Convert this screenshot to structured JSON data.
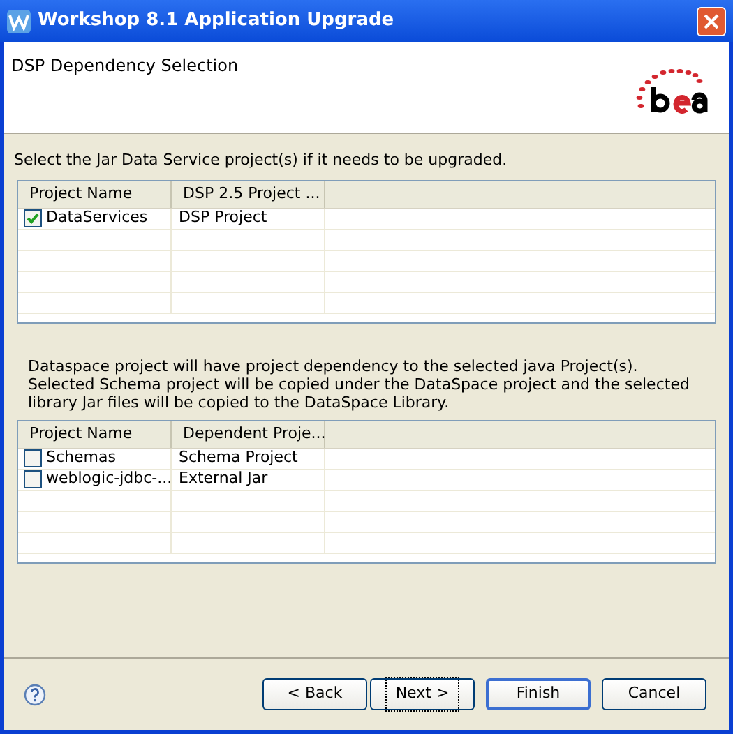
{
  "window": {
    "title": "Workshop 8.1 Application Upgrade"
  },
  "header": {
    "title": "DSP Dependency Selection"
  },
  "jar_section": {
    "instruction": "Select the Jar Data Service project(s) if it needs to be upgraded.",
    "columns": [
      "Project Name",
      "DSP 2.5 Project ..."
    ],
    "rows": [
      {
        "cells": [
          "DataServices",
          "DSP Project"
        ],
        "checked": true
      }
    ]
  },
  "dependency_section": {
    "instruction": "Dataspace project will have project dependency to the selected java Project(s). Selected Schema project will be copied under the DataSpace project and the selected library Jar files will be copied to the DataSpace Library.",
    "columns": [
      "Project Name",
      "Dependent Proje..."
    ],
    "rows": [
      {
        "cells": [
          "Schemas",
          "Schema Project"
        ],
        "checked": false
      },
      {
        "cells": [
          "weblogic-jdbc-...",
          "External Jar"
        ],
        "checked": false
      }
    ]
  },
  "buttons": [
    {
      "label": "< Back",
      "focused": false,
      "default": false
    },
    {
      "label": "Next >",
      "focused": true,
      "default": false
    },
    {
      "label": "Finish",
      "focused": false,
      "default": true
    },
    {
      "label": "Cancel",
      "focused": false,
      "default": false
    }
  ]
}
